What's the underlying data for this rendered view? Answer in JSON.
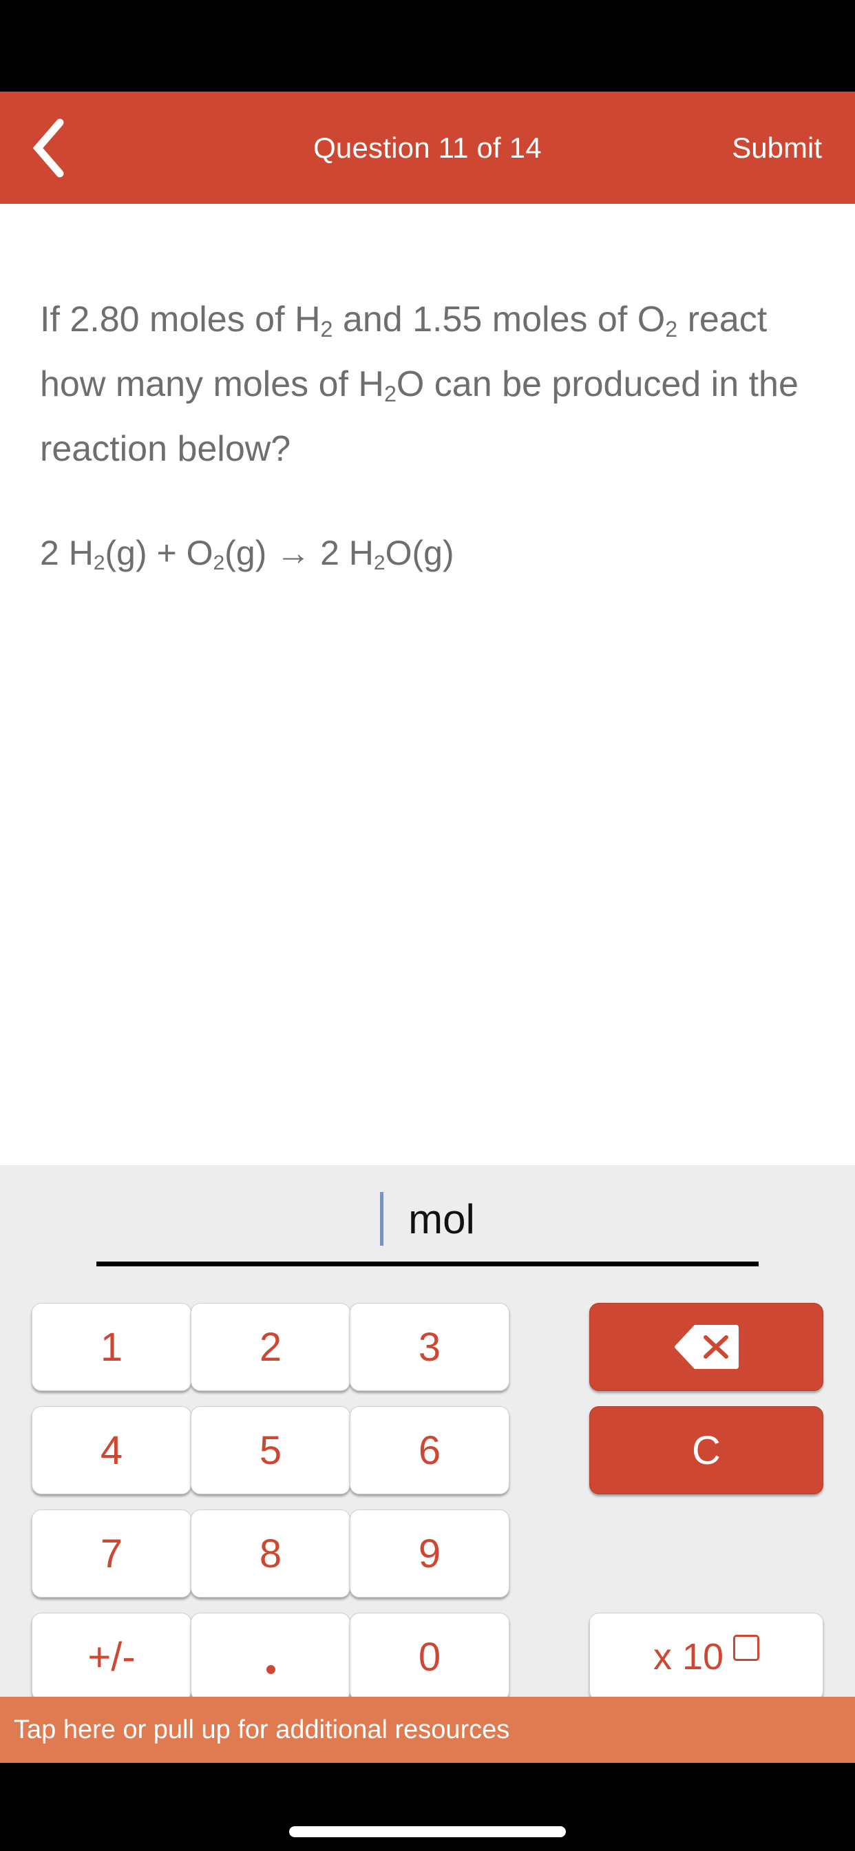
{
  "app": {
    "accent_color": "#CE4733",
    "banner_color": "#E07B51",
    "keypad_bg_color": "#EDEDED",
    "question_text_color": "#6E6E6E"
  },
  "nav": {
    "back_icon": "chevron-left-icon",
    "title": "Question 11 of 14",
    "submit_label": "Submit",
    "question_number": 11,
    "question_total": 14
  },
  "question": {
    "line1_a": "If 2.80 moles of H",
    "line1_sub": "2",
    "line1_b": " and 1.55 moles of O",
    "line2_sub": "2",
    "line2_b": " react how many moles of H",
    "line3_sub": "2",
    "line3_b": "O can be produced in the reaction below?",
    "full_text": "If 2.80 moles of H2 and 1.55 moles of O2 react how many moles of H2O can be produced in the reaction below?",
    "equation": "2 H₂(g) + O₂(g) → 2 H₂O(g)",
    "equation_parts": {
      "coef1": "2 H",
      "sub1": "2",
      "state1": "(g) + O",
      "sub2": "2",
      "state2": "(g) ",
      "arrow": "→",
      "coef2": " 2 H",
      "sub3": "2",
      "state3": "O(g)"
    }
  },
  "answer": {
    "value": "",
    "unit": "mol",
    "caret_color": "#7B94BE"
  },
  "keypad": {
    "keys": [
      {
        "id": "key-1",
        "label": "1",
        "type": "num"
      },
      {
        "id": "key-2",
        "label": "2",
        "type": "num"
      },
      {
        "id": "key-3",
        "label": "3",
        "type": "num"
      },
      {
        "id": "key-4",
        "label": "4",
        "type": "num"
      },
      {
        "id": "key-5",
        "label": "5",
        "type": "num"
      },
      {
        "id": "key-6",
        "label": "6",
        "type": "num"
      },
      {
        "id": "key-7",
        "label": "7",
        "type": "num"
      },
      {
        "id": "key-8",
        "label": "8",
        "type": "num"
      },
      {
        "id": "key-9",
        "label": "9",
        "type": "num"
      },
      {
        "id": "key-plusminus",
        "label": "+/-",
        "type": "num"
      },
      {
        "id": "key-decimal",
        "label": ".",
        "type": "num"
      },
      {
        "id": "key-0",
        "label": "0",
        "type": "num"
      }
    ],
    "backspace_icon": "backspace-delete-icon",
    "clear_label": "C",
    "exponent_label": "x 10",
    "exponent_placeholder_icon": "empty-exponent-box-icon"
  },
  "footer": {
    "resources_label": "Tap here or pull up for additional resources"
  }
}
